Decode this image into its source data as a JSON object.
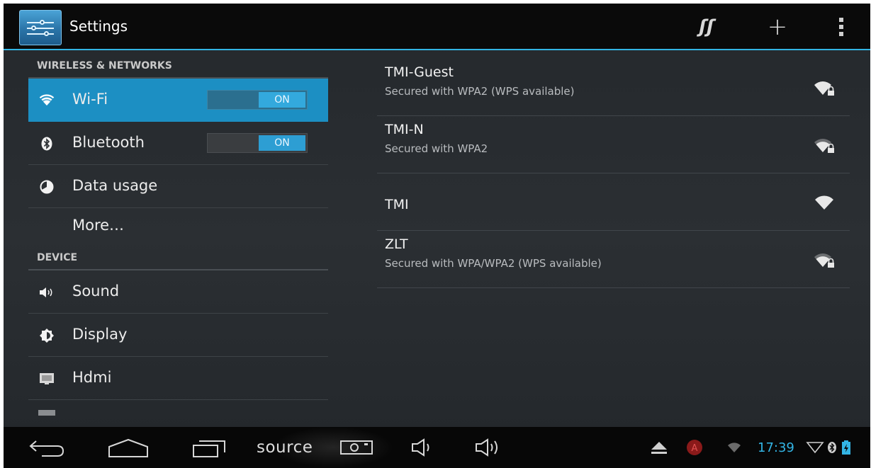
{
  "action_bar": {
    "title": "Settings",
    "app_icon": "settings-sliders-icon",
    "actions": [
      {
        "name": "sync",
        "icon": "wps-sync-icon",
        "glyph": "ʃʃ"
      },
      {
        "name": "add-network",
        "icon": "plus-icon",
        "glyph": "+"
      },
      {
        "name": "overflow-menu",
        "icon": "overflow-dots-icon"
      }
    ],
    "accent": "#33b5e5"
  },
  "sidebar": {
    "categories": [
      {
        "label": "WIRELESS & NETWORKS"
      },
      {
        "label": "DEVICE"
      }
    ],
    "items": [
      {
        "label": "Wi-Fi",
        "icon": "wifi-icon",
        "toggle": "ON",
        "selected": true
      },
      {
        "label": "Bluetooth",
        "icon": "bluetooth-icon",
        "toggle": "ON"
      },
      {
        "label": "Data usage",
        "icon": "data-usage-icon"
      },
      {
        "label": "More…"
      },
      {
        "label": "Sound",
        "icon": "speaker-icon"
      },
      {
        "label": "Display",
        "icon": "brightness-icon"
      },
      {
        "label": "Hdmi",
        "icon": "monitor-icon"
      }
    ],
    "selected_color": "#1c8fc3"
  },
  "networks": [
    {
      "ssid": "TMI-Guest",
      "security": "Secured with WPA2 (WPS available)",
      "signal_icon": "wifi-locked-icon",
      "locked": true
    },
    {
      "ssid": "TMI-N",
      "security": "Secured with WPA2",
      "signal_icon": "wifi-locked-icon",
      "locked": true
    },
    {
      "ssid": "TMI",
      "security": "",
      "signal_icon": "wifi-open-icon",
      "locked": false
    },
    {
      "ssid": "ZLT",
      "security": "Secured with WPA/WPA2 (WPS available)",
      "signal_icon": "wifi-locked-icon",
      "locked": true
    }
  ],
  "nav_bar": {
    "buttons": [
      {
        "name": "back",
        "icon": "back-arrow-icon"
      },
      {
        "name": "home",
        "icon": "home-icon"
      },
      {
        "name": "recents",
        "icon": "recents-icon"
      }
    ],
    "source_label": "source",
    "extra_icons": [
      "screenshot-icon",
      "volume-down-icon",
      "volume-up-icon"
    ],
    "status": {
      "icons": [
        "eject-icon",
        "alert-icon",
        "wifi-status-icon"
      ],
      "time": "17:39",
      "trailing_icons": [
        "signal-icon",
        "bluetooth-status-icon",
        "battery-icon"
      ]
    }
  }
}
